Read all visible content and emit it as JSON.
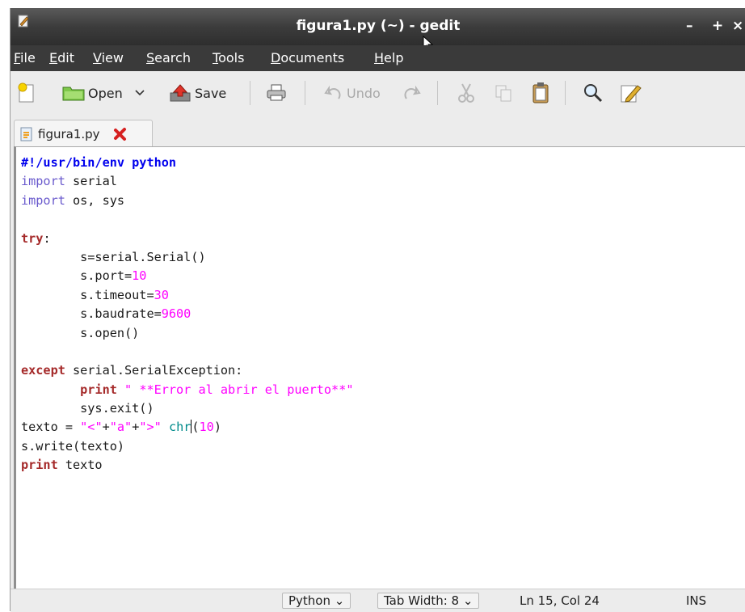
{
  "window": {
    "title": "figura1.py (~) - gedit",
    "min": "–",
    "max": "+",
    "close": "×"
  },
  "menu": [
    "File",
    "Edit",
    "View",
    "Search",
    "Tools",
    "Documents",
    "Help"
  ],
  "toolbar": {
    "open": "Open",
    "save": "Save",
    "undo": "Undo"
  },
  "tab": {
    "label": "figura1.py"
  },
  "code": [
    [
      [
        "shebang",
        "#!/usr/bin/env python"
      ]
    ],
    [
      [
        "imp",
        "import"
      ],
      [
        "",
        " serial"
      ]
    ],
    [
      [
        "imp",
        "import"
      ],
      [
        "",
        " os, sys"
      ]
    ],
    [
      [
        "",
        ""
      ]
    ],
    [
      [
        "kw",
        "try"
      ],
      [
        "",
        ":"
      ]
    ],
    [
      [
        "",
        "        s=serial.Serial()"
      ]
    ],
    [
      [
        "",
        "        s.port="
      ],
      [
        "num",
        "10"
      ]
    ],
    [
      [
        "",
        "        s.timeout="
      ],
      [
        "num",
        "30"
      ]
    ],
    [
      [
        "",
        "        s.baudrate="
      ],
      [
        "num",
        "9600"
      ]
    ],
    [
      [
        "",
        "        s.open()"
      ]
    ],
    [
      [
        "",
        ""
      ]
    ],
    [
      [
        "kw",
        "except"
      ],
      [
        "",
        " serial.SerialException:"
      ]
    ],
    [
      [
        "",
        "        "
      ],
      [
        "kw",
        "print"
      ],
      [
        "",
        " "
      ],
      [
        "str",
        "\" **Error al abrir el puerto**\""
      ]
    ],
    [
      [
        "",
        "        sys.exit()"
      ]
    ],
    [
      [
        "",
        "texto = "
      ],
      [
        "str",
        "\"<\""
      ],
      [
        "",
        "+"
      ],
      [
        "str",
        "\"a\""
      ],
      [
        "",
        "+"
      ],
      [
        "str",
        "\">\""
      ],
      [
        "",
        " "
      ],
      [
        "bi",
        "chr"
      ],
      [
        "caret",
        ""
      ],
      [
        "",
        "("
      ],
      [
        "num",
        "10"
      ],
      [
        "",
        ")"
      ]
    ],
    [
      [
        "",
        "s.write(texto)"
      ]
    ],
    [
      [
        "kw",
        "print"
      ],
      [
        "",
        " texto"
      ]
    ]
  ],
  "status": {
    "language": "Python",
    "tab_width": "Tab Width:  8",
    "position": "Ln 15, Col 24",
    "mode": "INS"
  }
}
